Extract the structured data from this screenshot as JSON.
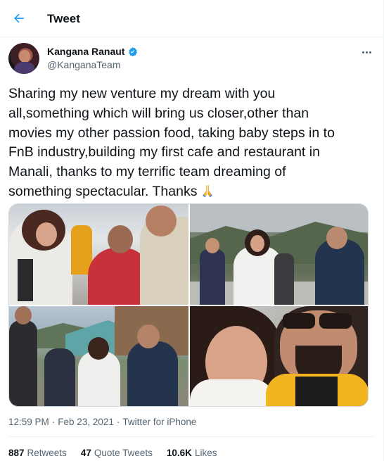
{
  "header": {
    "title": "Tweet",
    "back_icon": "arrow-left-icon",
    "accent": "#1d9bf0"
  },
  "author": {
    "name": "Kangana Ranaut",
    "handle": "@KanganaTeam",
    "verified": true,
    "verified_color": "#1d9bf0"
  },
  "tweet": {
    "text_lines": [
      "Sharing my new venture my dream with you",
      "all,something which will bring us closer,other than",
      "movies my other passion food, taking baby steps in to",
      "FnB industry,building my first cafe and restaurant in",
      "Manali, thanks to my terrific team dreaming of",
      "something spectacular. Thanks"
    ],
    "emoji": "folded-hands-icon"
  },
  "media": {
    "photo_count": 4
  },
  "meta": {
    "time": "12:59 PM",
    "separator": "·",
    "date": "Feb 23, 2021",
    "source": "Twitter for iPhone"
  },
  "stats": [
    {
      "count": "887",
      "label": "Retweets"
    },
    {
      "count": "47",
      "label": "Quote Tweets"
    },
    {
      "count": "10.6K",
      "label": "Likes"
    }
  ]
}
